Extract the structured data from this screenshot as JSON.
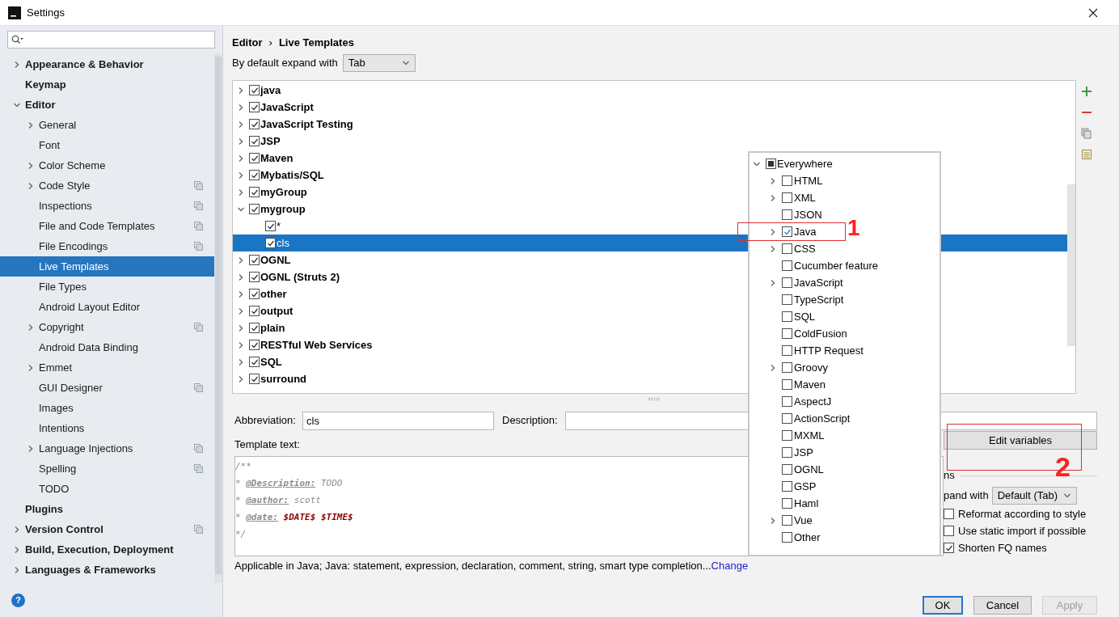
{
  "window": {
    "title": "Settings"
  },
  "sidebar": {
    "items": [
      {
        "label": "Appearance & Behavior",
        "expandable": true,
        "expanded": false,
        "selected": false,
        "project_level": false
      },
      {
        "label": "Keymap",
        "expandable": false,
        "selected": false,
        "project_level": false
      },
      {
        "label": "Editor",
        "expandable": true,
        "expanded": true,
        "selected": false,
        "project_level": false,
        "children": [
          {
            "label": "General",
            "expandable": true,
            "expanded": false,
            "selected": false,
            "project_level": false
          },
          {
            "label": "Font",
            "expandable": false,
            "selected": false,
            "project_level": false
          },
          {
            "label": "Color Scheme",
            "expandable": true,
            "expanded": false,
            "selected": false,
            "project_level": false
          },
          {
            "label": "Code Style",
            "expandable": true,
            "expanded": false,
            "selected": false,
            "project_level": true
          },
          {
            "label": "Inspections",
            "expandable": false,
            "selected": false,
            "project_level": true
          },
          {
            "label": "File and Code Templates",
            "expandable": false,
            "selected": false,
            "project_level": true
          },
          {
            "label": "File Encodings",
            "expandable": false,
            "selected": false,
            "project_level": true
          },
          {
            "label": "Live Templates",
            "expandable": false,
            "selected": true,
            "project_level": false
          },
          {
            "label": "File Types",
            "expandable": false,
            "selected": false,
            "project_level": false
          },
          {
            "label": "Android Layout Editor",
            "expandable": false,
            "selected": false,
            "project_level": false
          },
          {
            "label": "Copyright",
            "expandable": true,
            "expanded": false,
            "selected": false,
            "project_level": true
          },
          {
            "label": "Android Data Binding",
            "expandable": false,
            "selected": false,
            "project_level": false
          },
          {
            "label": "Emmet",
            "expandable": true,
            "expanded": false,
            "selected": false,
            "project_level": false
          },
          {
            "label": "GUI Designer",
            "expandable": false,
            "selected": false,
            "project_level": true
          },
          {
            "label": "Images",
            "expandable": false,
            "selected": false,
            "project_level": false
          },
          {
            "label": "Intentions",
            "expandable": false,
            "selected": false,
            "project_level": false
          },
          {
            "label": "Language Injections",
            "expandable": true,
            "expanded": false,
            "selected": false,
            "project_level": true
          },
          {
            "label": "Spelling",
            "expandable": false,
            "selected": false,
            "project_level": true
          },
          {
            "label": "TODO",
            "expandable": false,
            "selected": false,
            "project_level": false
          }
        ]
      },
      {
        "label": "Plugins",
        "expandable": false,
        "selected": false,
        "project_level": false
      },
      {
        "label": "Version Control",
        "expandable": true,
        "expanded": false,
        "selected": false,
        "project_level": true
      },
      {
        "label": "Build, Execution, Deployment",
        "expandable": true,
        "expanded": false,
        "selected": false,
        "project_level": false
      },
      {
        "label": "Languages & Frameworks",
        "expandable": true,
        "expanded": false,
        "selected": false,
        "project_level": false
      }
    ],
    "help": "?"
  },
  "breadcrumb": {
    "parent": "Editor",
    "separator": "›",
    "current": "Live Templates"
  },
  "expand_with": {
    "label": "By default expand with",
    "value": "Tab"
  },
  "template_groups": [
    {
      "name": "java",
      "checked": true,
      "expanded": false,
      "selected": false
    },
    {
      "name": "JavaScript",
      "checked": true,
      "expanded": false,
      "selected": false
    },
    {
      "name": "JavaScript Testing",
      "checked": true,
      "expanded": false,
      "selected": false
    },
    {
      "name": "JSP",
      "checked": true,
      "expanded": false,
      "selected": false
    },
    {
      "name": "Maven",
      "checked": true,
      "expanded": false,
      "selected": false
    },
    {
      "name": "Mybatis/SQL",
      "checked": true,
      "expanded": false,
      "selected": false
    },
    {
      "name": "myGroup",
      "checked": true,
      "expanded": false,
      "selected": false
    },
    {
      "name": "mygroup",
      "checked": true,
      "expanded": true,
      "selected": false,
      "children": [
        {
          "name": "*",
          "checked": true,
          "selected": false
        },
        {
          "name": "cls",
          "checked": true,
          "selected": true
        }
      ]
    },
    {
      "name": "OGNL",
      "checked": true,
      "expanded": false,
      "selected": false
    },
    {
      "name": "OGNL (Struts 2)",
      "checked": true,
      "expanded": false,
      "selected": false
    },
    {
      "name": "other",
      "checked": true,
      "expanded": false,
      "selected": false
    },
    {
      "name": "output",
      "checked": true,
      "expanded": false,
      "selected": false
    },
    {
      "name": "plain",
      "checked": true,
      "expanded": false,
      "selected": false
    },
    {
      "name": "RESTful Web Services",
      "checked": true,
      "expanded": false,
      "selected": false
    },
    {
      "name": "SQL",
      "checked": true,
      "expanded": false,
      "selected": false
    },
    {
      "name": "surround",
      "checked": true,
      "expanded": false,
      "selected": false
    }
  ],
  "editor": {
    "abbreviation": {
      "label": "Abbreviation:",
      "value": "cls"
    },
    "description": {
      "label": "Description:"
    },
    "template_text": {
      "label": "Template text:",
      "lines": [
        [
          {
            "kind": "comment",
            "text": "/**"
          }
        ],
        [
          {
            "kind": "comment",
            "text": "* "
          },
          {
            "kind": "tag",
            "text": "@Description:"
          },
          {
            "kind": "comment",
            "text": " TODO"
          }
        ],
        [
          {
            "kind": "comment",
            "text": "* "
          },
          {
            "kind": "tag",
            "text": "@author:"
          },
          {
            "kind": "comment",
            "text": " scott"
          }
        ],
        [
          {
            "kind": "comment",
            "text": "* "
          },
          {
            "kind": "tag",
            "text": "@date:"
          },
          {
            "kind": "variable",
            "text": " $DATE$"
          },
          {
            "kind": "variable",
            "text": " $TIME$"
          }
        ],
        [
          {
            "kind": "comment",
            "text": "*/"
          }
        ]
      ]
    },
    "applicable": {
      "text": "Applicable in Java; Java: statement, expression, declaration, comment, string, smart type completion...",
      "link": "Change"
    },
    "edit_variables": "Edit variables",
    "options": {
      "header": "ns",
      "expand_label": "pand with",
      "expand_value": "Default (Tab)",
      "checkboxes": [
        {
          "label": "Reformat according to style",
          "checked": false
        },
        {
          "label": "Use static import if possible",
          "checked": false
        },
        {
          "label": "Shorten FQ names",
          "checked": true
        }
      ]
    }
  },
  "context_popup": {
    "root": {
      "label": "Everywhere",
      "expanded": true,
      "mixed": true
    },
    "items": [
      {
        "label": "HTML",
        "expandable": true,
        "checked": false
      },
      {
        "label": "XML",
        "expandable": true,
        "checked": false
      },
      {
        "label": "JSON",
        "expandable": false,
        "checked": false
      },
      {
        "label": "Java",
        "expandable": true,
        "checked": true
      },
      {
        "label": "CSS",
        "expandable": true,
        "checked": false
      },
      {
        "label": "Cucumber feature",
        "expandable": false,
        "checked": false
      },
      {
        "label": "JavaScript",
        "expandable": true,
        "checked": false
      },
      {
        "label": "TypeScript",
        "expandable": false,
        "checked": false
      },
      {
        "label": "SQL",
        "expandable": false,
        "checked": false
      },
      {
        "label": "ColdFusion",
        "expandable": false,
        "checked": false
      },
      {
        "label": "HTTP Request",
        "expandable": false,
        "checked": false
      },
      {
        "label": "Groovy",
        "expandable": true,
        "checked": false
      },
      {
        "label": "Maven",
        "expandable": false,
        "checked": false
      },
      {
        "label": "AspectJ",
        "expandable": false,
        "checked": false
      },
      {
        "label": "ActionScript",
        "expandable": false,
        "checked": false
      },
      {
        "label": "MXML",
        "expandable": false,
        "checked": false
      },
      {
        "label": "JSP",
        "expandable": false,
        "checked": false
      },
      {
        "label": "OGNL",
        "expandable": false,
        "checked": false
      },
      {
        "label": "GSP",
        "expandable": false,
        "checked": false
      },
      {
        "label": "Haml",
        "expandable": false,
        "checked": false
      },
      {
        "label": "Vue",
        "expandable": true,
        "checked": false
      },
      {
        "label": "Other",
        "expandable": false,
        "checked": false
      }
    ]
  },
  "buttons": [
    {
      "label": "OK",
      "kind": "default"
    },
    {
      "label": "Cancel",
      "kind": "normal"
    },
    {
      "label": "Apply",
      "kind": "disabled"
    }
  ],
  "annotations": [
    {
      "text": "1"
    },
    {
      "text": "2"
    }
  ]
}
